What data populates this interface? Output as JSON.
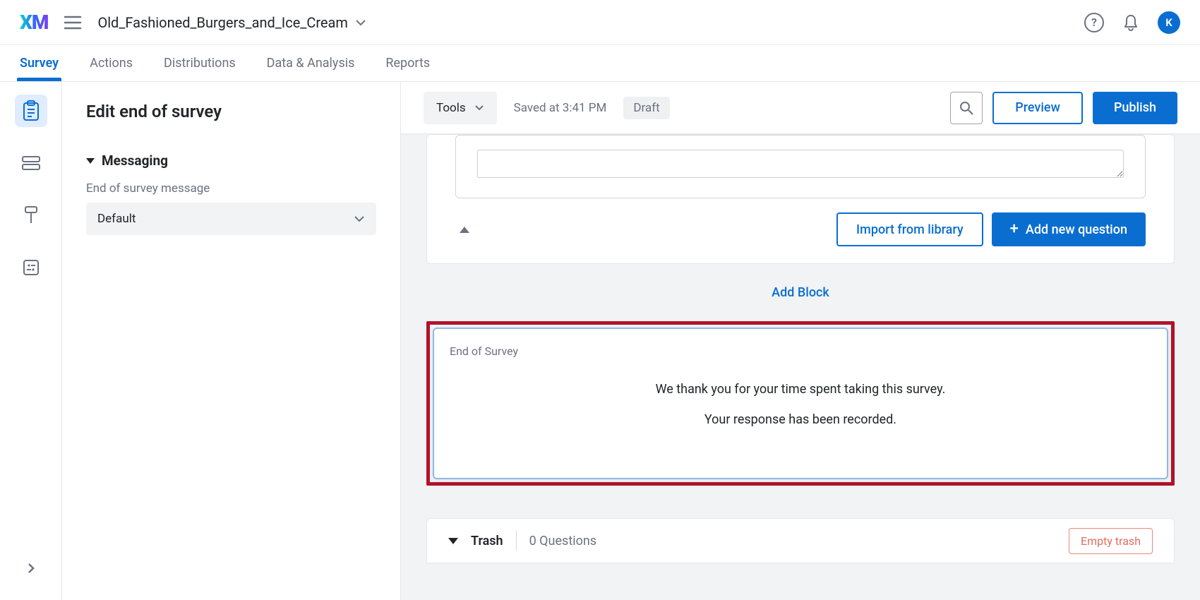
{
  "header": {
    "project_name": "Old_Fashioned_Burgers_and_Ice_Cream",
    "avatar_initial": "K"
  },
  "tabs": [
    {
      "label": "Survey",
      "active": true
    },
    {
      "label": "Actions",
      "active": false
    },
    {
      "label": "Distributions",
      "active": false
    },
    {
      "label": "Data & Analysis",
      "active": false
    },
    {
      "label": "Reports",
      "active": false
    }
  ],
  "sidebar": {
    "title": "Edit end of survey",
    "section_label": "Messaging",
    "field_label": "End of survey message",
    "select_value": "Default"
  },
  "toolbar": {
    "tools_label": "Tools",
    "saved_text": "Saved at 3:41 PM",
    "status_badge": "Draft",
    "preview_label": "Preview",
    "publish_label": "Publish"
  },
  "question_block": {
    "import_label": "Import from library",
    "add_question_label": "Add new question"
  },
  "add_block_label": "Add Block",
  "end_of_survey": {
    "heading": "End of Survey",
    "line1": "We thank you for your time spent taking this survey.",
    "line2": "Your response has been recorded."
  },
  "trash": {
    "label": "Trash",
    "count_text": "0 Questions",
    "empty_label": "Empty trash"
  }
}
